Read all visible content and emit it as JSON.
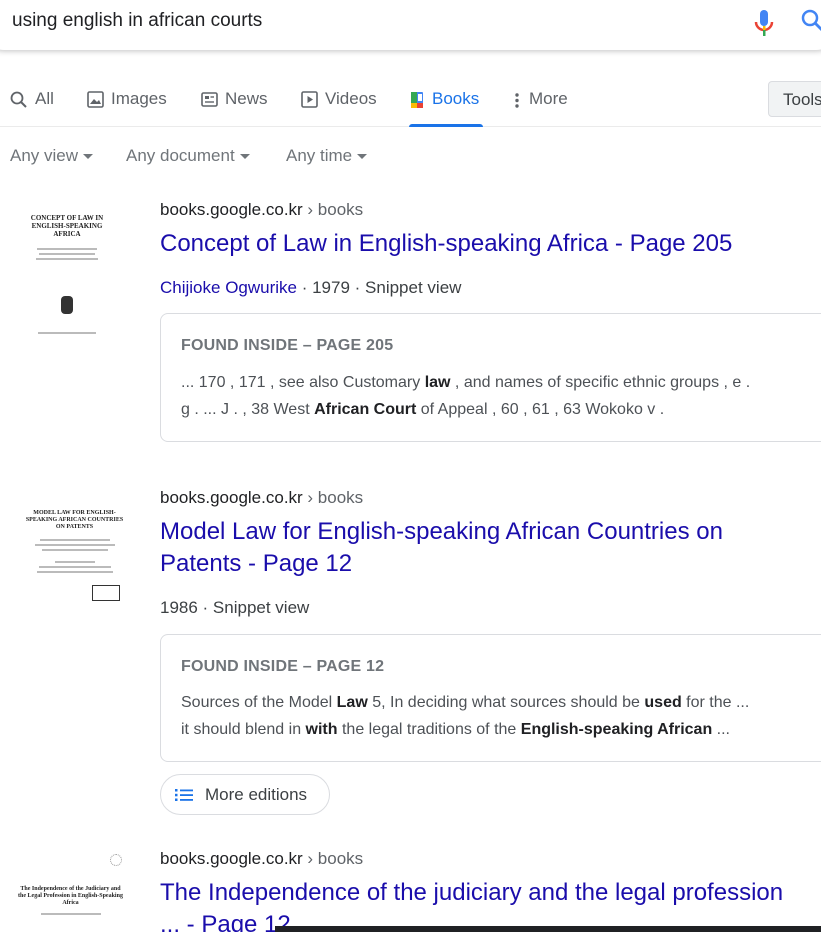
{
  "search": {
    "query": "using english in african courts"
  },
  "tabs": [
    {
      "label": "All",
      "icon": "search-icon"
    },
    {
      "label": "Images",
      "icon": "image-icon"
    },
    {
      "label": "News",
      "icon": "news-icon"
    },
    {
      "label": "Videos",
      "icon": "video-icon"
    },
    {
      "label": "Books",
      "icon": "book-icon",
      "active": true
    },
    {
      "label": "More",
      "icon": "more-vert-icon"
    }
  ],
  "tools_label": "Tools",
  "filters": [
    "Any view",
    "Any document",
    "Any time"
  ],
  "results": [
    {
      "domain": "books.google.co.kr",
      "crumb": " › books",
      "title": "Concept of Law in English-speaking Africa - Page 205",
      "author": "Chijioke Ogwurike",
      "meta": " · 1979 · Snippet view",
      "found": "FOUND INSIDE – PAGE 205",
      "thumb_title": "CONCEPT OF LAW IN ENGLISH-SPEAKING AFRICA",
      "snippet": {
        "line1_a": "... 170 , 171 , see also Customary ",
        "line1_b": "law",
        "line1_c": " , and names of specific ethnic groups , e .",
        "line2_a": "g . ... J . , 38 West ",
        "line2_b": "African Court",
        "line2_c": " of Appeal , 60 , 61 , 63 Wokoko v ."
      }
    },
    {
      "domain": "books.google.co.kr",
      "crumb": " › books",
      "title_line1": "Model Law for English-speaking African Countries on",
      "title_line2": "Patents - Page 12",
      "meta": "1986 · Snippet view",
      "found": "FOUND INSIDE – PAGE 12",
      "thumb_title": "MODEL LAW FOR ENGLISH-SPEAKING AFRICAN COUNTRIES ON PATENTS",
      "snippet": {
        "line1_a": "Sources of the Model ",
        "line1_b": "Law",
        "line1_c": " 5, In deciding what sources should be ",
        "line1_d": "used",
        "line1_e": " for the ...",
        "line2_a": "it should blend in ",
        "line2_b": "with",
        "line2_c": " the legal traditions of the ",
        "line2_d": "English-speaking African",
        "line2_e": " ..."
      },
      "more_editions": "More editions"
    },
    {
      "domain": "books.google.co.kr",
      "crumb": " › books",
      "title_line1": "The Independence of the judiciary and the legal profession",
      "title_line2": "... - Page 12",
      "thumb_title": "The Independence of the Judiciary and the Legal Profession in English-Speaking Africa"
    }
  ],
  "colors": {
    "link": "#1a0dab",
    "accent": "#1a73e8",
    "muted": "#70757a"
  }
}
